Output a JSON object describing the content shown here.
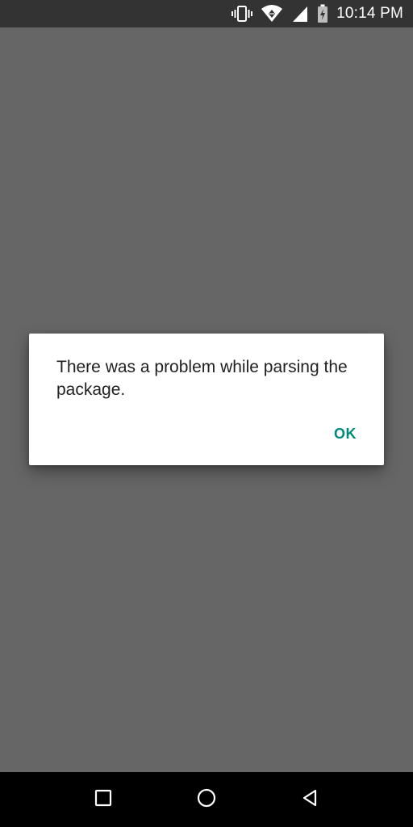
{
  "status_bar": {
    "time": "10:14 PM",
    "icons": [
      "vibrate-icon",
      "wifi-icon",
      "signal-icon",
      "battery-charging-icon"
    ]
  },
  "dialog": {
    "message": "There was a problem while parsing the package.",
    "ok_label": "OK",
    "accent_color": "#00897b"
  },
  "nav_bar": {
    "buttons": [
      "recents-button",
      "home-button",
      "back-button"
    ]
  }
}
